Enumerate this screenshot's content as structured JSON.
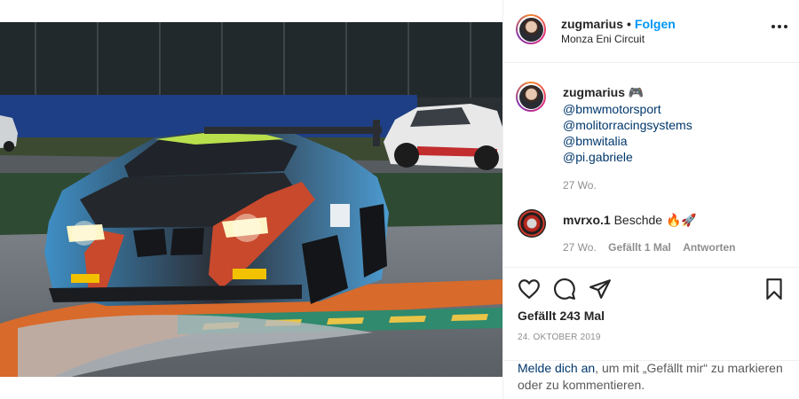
{
  "header": {
    "username": "zugmarius",
    "separator": "•",
    "follow_label": "Folgen",
    "location": "Monza Eni Circuit",
    "more_icon": "more-horizontal-icon"
  },
  "caption": {
    "username": "zugmarius",
    "emoji": "🎮",
    "mentions": [
      "@bmwmotorsport",
      "@molitorracingsystems",
      "@bmwitalia",
      "@pi.gabriele"
    ],
    "time": "27 Wo."
  },
  "comments": [
    {
      "username": "mvrxo.1",
      "text": "Beschde 🔥🚀",
      "time": "27 Wo.",
      "likes": "Gefällt 1 Mal",
      "reply_label": "Antworten"
    }
  ],
  "actions": {
    "icons": [
      "heart-icon",
      "comment-icon",
      "share-icon",
      "bookmark-icon"
    ],
    "likes": "Gefällt 243 Mal",
    "date": "24. OKTOBER 2019"
  },
  "login": {
    "link_label": "Melde dich an",
    "rest": ", um mit „Gefällt mir“ zu markieren oder zu kommentieren."
  },
  "colors": {
    "accent": "#0095f6",
    "link": "#00376b",
    "muted": "#8e8e8e",
    "text": "#262626"
  }
}
